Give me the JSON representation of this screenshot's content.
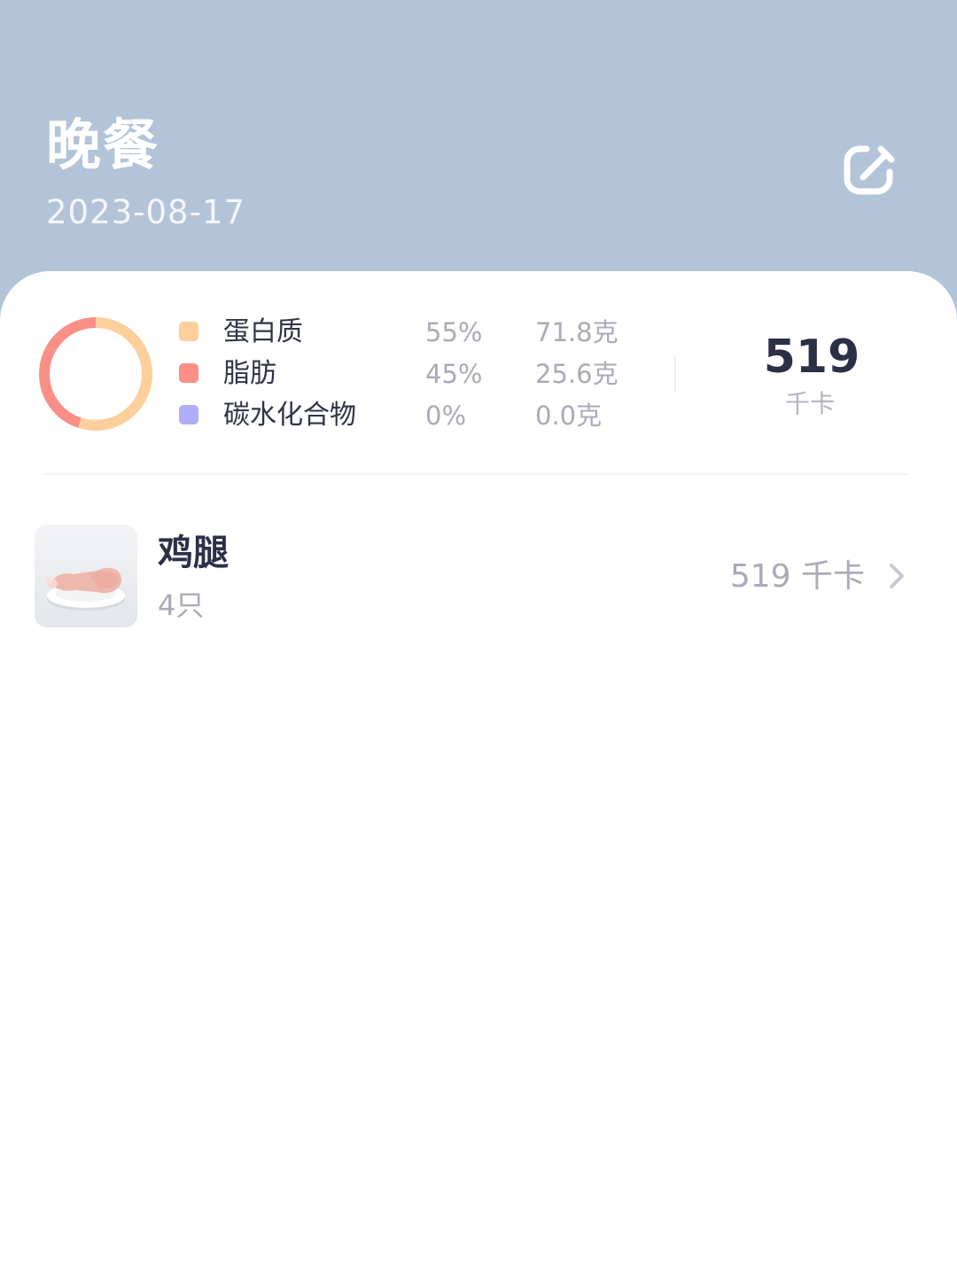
{
  "header": {
    "title": "晚餐",
    "date": "2023-08-17",
    "edit_icon": "edit-icon"
  },
  "summary": {
    "chart_data": {
      "type": "pie",
      "categories": [
        "蛋白质",
        "脂肪",
        "碳水化合物"
      ],
      "values": [
        55,
        45,
        0
      ],
      "colors": [
        "#fdcf9b",
        "#fa8f88",
        "#aeaef8"
      ]
    },
    "nutrients": [
      {
        "name": "蛋白质",
        "percent": "55%",
        "grams": "71.8克",
        "color": "#fdcf9b"
      },
      {
        "name": "脂肪",
        "percent": "45%",
        "grams": "25.6克",
        "color": "#fa8f88"
      },
      {
        "name": "碳水化合物",
        "percent": "0%",
        "grams": "0.0克",
        "color": "#aeaef8"
      }
    ],
    "total_kcal": "519",
    "total_unit": "千卡"
  },
  "foods": [
    {
      "name": "鸡腿",
      "quantity": "4只",
      "kcal": "519 千卡",
      "thumbnail_icon": "chicken-leg-photo",
      "chevron_icon": "chevron-right-icon"
    }
  ]
}
